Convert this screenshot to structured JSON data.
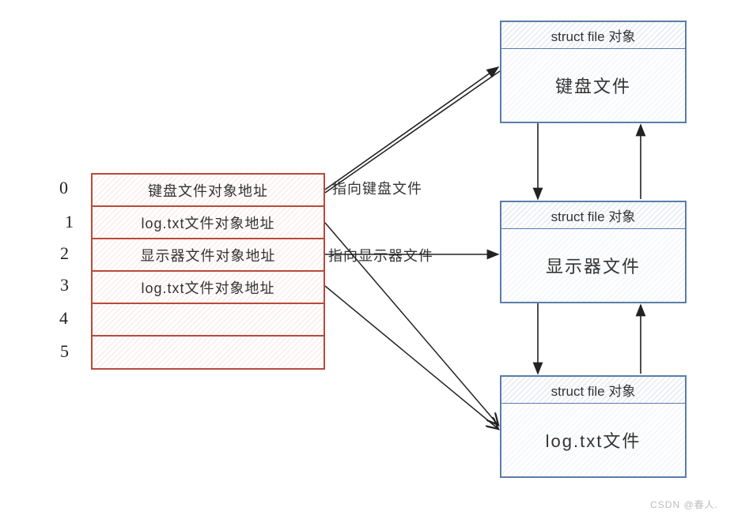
{
  "indices": [
    "0",
    "1",
    "2",
    "3",
    "4",
    "5"
  ],
  "table": {
    "rows": [
      "键盘文件对象地址",
      "log.txt文件对象地址",
      "显示器文件对象地址",
      "log.txt文件对象地址",
      "",
      ""
    ]
  },
  "arrows": {
    "label_keyboard": "指向键盘文件",
    "label_display": "指向显示器文件"
  },
  "struct_boxes": {
    "header_label": "struct file 对象",
    "box1_body": "键盘文件",
    "box2_body": "显示器文件",
    "box3_body": "log.txt文件"
  },
  "watermark": "CSDN @春人."
}
